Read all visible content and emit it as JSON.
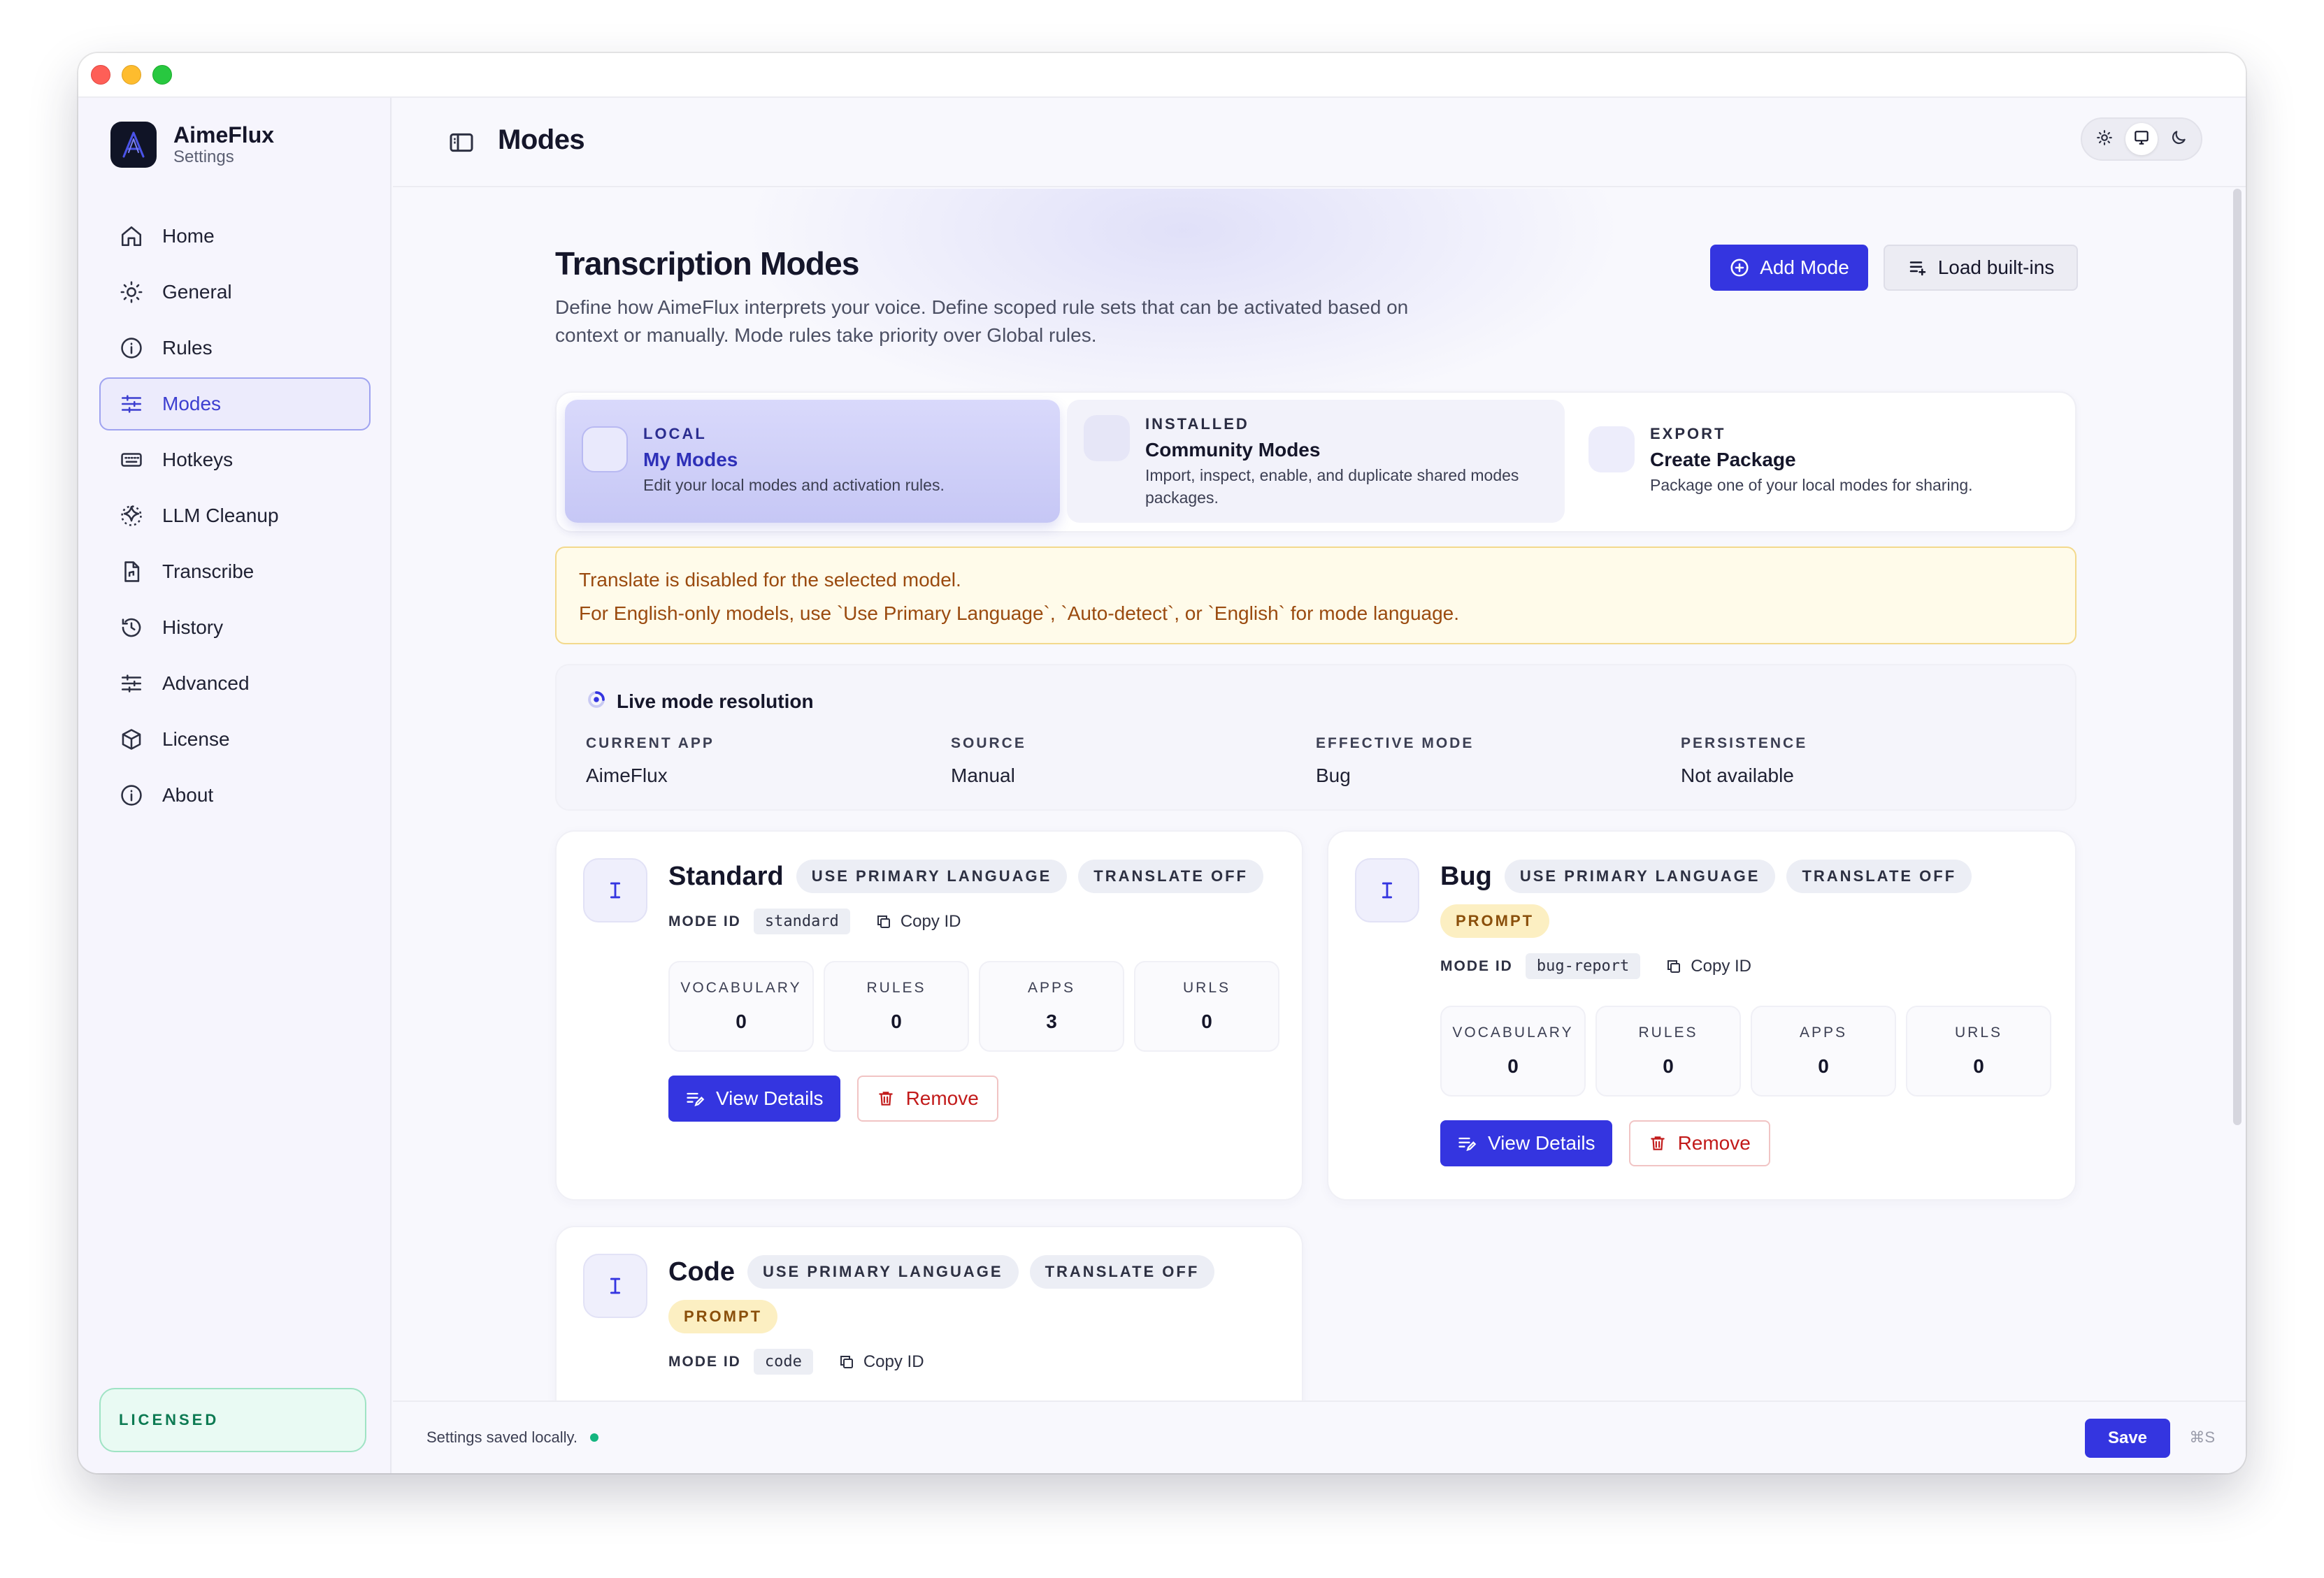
{
  "app": {
    "name": "AimeFlux",
    "subtitle": "Settings"
  },
  "sidebar": {
    "items": [
      {
        "label": "Home",
        "icon": "home-icon"
      },
      {
        "label": "General",
        "icon": "sun-icon"
      },
      {
        "label": "Rules",
        "icon": "info-icon"
      },
      {
        "label": "Modes",
        "icon": "sliders-icon",
        "active": true
      },
      {
        "label": "Hotkeys",
        "icon": "keyboard-icon"
      },
      {
        "label": "LLM Cleanup",
        "icon": "sparkle-icon"
      },
      {
        "label": "Transcribe",
        "icon": "file-audio-icon"
      },
      {
        "label": "History",
        "icon": "history-icon"
      },
      {
        "label": "Advanced",
        "icon": "sliders-icon"
      },
      {
        "label": "License",
        "icon": "box-icon"
      },
      {
        "label": "About",
        "icon": "info-icon"
      }
    ],
    "license_badge": "LICENSED"
  },
  "topbar": {
    "title": "Modes",
    "theme_options": [
      "light",
      "system",
      "dark"
    ],
    "theme_selected": "system"
  },
  "page": {
    "title": "Transcription Modes",
    "description": "Define how AimeFlux interprets your voice. Define scoped rule sets that can be activated based on context or manually. Mode rules take priority over Global rules.",
    "add_mode_label": "Add Mode",
    "load_builtins_label": "Load built-ins"
  },
  "segments": [
    {
      "kicker": "LOCAL",
      "title": "My Modes",
      "description": "Edit your local modes and activation rules.",
      "selected": true
    },
    {
      "kicker": "INSTALLED",
      "title": "Community Modes",
      "description": "Import, inspect, enable, and duplicate shared modes packages.",
      "selected": false
    },
    {
      "kicker": "EXPORT",
      "title": "Create Package",
      "description": "Package one of your local modes for sharing.",
      "selected": false
    }
  ],
  "alert": {
    "line1": "Translate is disabled for the selected model.",
    "line2": "For English-only models, use `Use Primary Language`, `Auto-detect`, or `English` for mode language."
  },
  "live": {
    "title": "Live mode resolution",
    "fields": [
      {
        "key": "CURRENT APP",
        "value": "AimeFlux"
      },
      {
        "key": "SOURCE",
        "value": "Manual"
      },
      {
        "key": "EFFECTIVE MODE",
        "value": "Bug"
      },
      {
        "key": "PERSISTENCE",
        "value": "Not available"
      }
    ]
  },
  "modes": [
    {
      "name": "Standard",
      "badges": [
        "USE PRIMARY LANGUAGE",
        "TRANSLATE OFF"
      ],
      "mode_id_label": "MODE ID",
      "mode_id": "standard",
      "copy_label": "Copy ID",
      "stats": [
        {
          "key": "VOCABULARY",
          "value": "0"
        },
        {
          "key": "RULES",
          "value": "0"
        },
        {
          "key": "APPS",
          "value": "3"
        },
        {
          "key": "URLS",
          "value": "0"
        }
      ],
      "view_label": "View Details",
      "remove_label": "Remove"
    },
    {
      "name": "Bug",
      "badges": [
        "USE PRIMARY LANGUAGE",
        "TRANSLATE OFF"
      ],
      "prompt_badge": "PROMPT",
      "mode_id_label": "MODE ID",
      "mode_id": "bug-report",
      "copy_label": "Copy ID",
      "stats": [
        {
          "key": "VOCABULARY",
          "value": "0"
        },
        {
          "key": "RULES",
          "value": "0"
        },
        {
          "key": "APPS",
          "value": "0"
        },
        {
          "key": "URLS",
          "value": "0"
        }
      ],
      "view_label": "View Details",
      "remove_label": "Remove"
    },
    {
      "name": "Code",
      "badges": [
        "USE PRIMARY LANGUAGE",
        "TRANSLATE OFF"
      ],
      "prompt_badge": "PROMPT",
      "mode_id_label": "MODE ID",
      "mode_id": "code",
      "copy_label": "Copy ID"
    }
  ],
  "footer": {
    "status": "Settings saved locally.",
    "save_label": "Save",
    "shortcut": "⌘S"
  },
  "colors": {
    "accent": "#3435e0",
    "danger": "#c21a1a",
    "success": "#14b57f",
    "warning_text": "#9a4a0f"
  }
}
